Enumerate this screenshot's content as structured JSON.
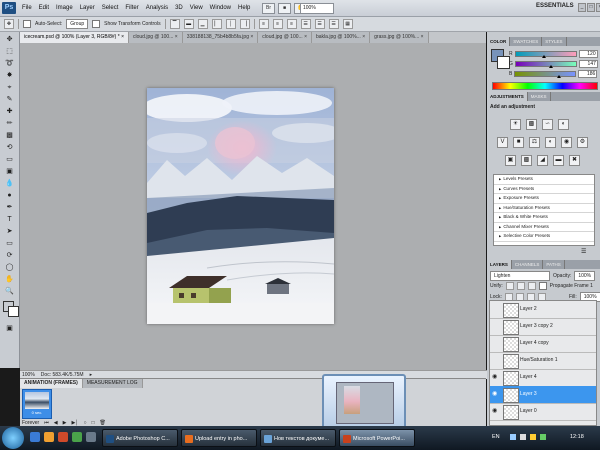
{
  "app": {
    "logo": "Ps"
  },
  "menu": [
    "File",
    "Edit",
    "Image",
    "Layer",
    "Select",
    "Filter",
    "Analysis",
    "3D",
    "View",
    "Window",
    "Help"
  ],
  "appbar": {
    "zoom": "100%",
    "workspace": "ESSENTIALS",
    "window_controls": [
      "_",
      "□",
      "×"
    ]
  },
  "options": {
    "auto_select_label": "Auto-Select:",
    "auto_select_value": "Group",
    "transform_label": "Show Transform Controls"
  },
  "doc_tabs": [
    {
      "label": "icecream.psd @ 100% (Layer 3, RGB/8#) *",
      "close": "×"
    },
    {
      "label": "cloud.jpg @ 100...",
      "close": "×"
    },
    {
      "label": "338188138_75b4b8b5fa.jpg",
      "close": "×"
    },
    {
      "label": "cloud.jpg @ 100...",
      "close": "×"
    },
    {
      "label": "bakla.jpg @ 100%...",
      "close": "×"
    },
    {
      "label": "grass.jpg @ 100%...",
      "close": "×"
    }
  ],
  "status": {
    "zoom": "100%",
    "doc": "Doc: 583.4K/5.75M"
  },
  "animation": {
    "tabs": [
      "ANIMATION (FRAMES)",
      "MEASUREMENT LOG"
    ],
    "frame_time": "0 sec.",
    "loop": "Forever"
  },
  "color_panel": {
    "tabs": [
      "COLOR",
      "SWATCHES",
      "STYLES"
    ],
    "channels": [
      {
        "label": "R",
        "value": "120",
        "position": 0.47,
        "gradient": "linear-gradient(90deg,#009dba,#ff9dba)"
      },
      {
        "label": "G",
        "value": "147",
        "position": 0.58,
        "gradient": "linear-gradient(90deg,#7800ba,#78ffba)"
      },
      {
        "label": "B",
        "value": "186",
        "position": 0.73,
        "gradient": "linear-gradient(90deg,#789300,#7893ff)"
      }
    ],
    "foreground": "#7893ba",
    "background": "#ffffff"
  },
  "adjustments": {
    "tabs": [
      "ADJUSTMENTS",
      "MASKS"
    ],
    "title": "Add an adjustment",
    "presets": [
      "Levels Presets",
      "Curves Presets",
      "Exposure Presets",
      "Hue/Saturation Presets",
      "Black & White Presets",
      "Channel Mixer Presets",
      "Selective Color Presets"
    ]
  },
  "layers_panel": {
    "tabs": [
      "LAYERS",
      "CHANNELS",
      "PATHS"
    ],
    "blend_mode": "Lighten",
    "opacity_label": "Opacity:",
    "opacity": "100%",
    "unify_label": "Unify:",
    "propagate_label": "Propagate Frame 1",
    "lock_label": "Lock:",
    "fill_label": "Fill:",
    "fill": "100%",
    "layers": [
      {
        "name": "Layer 2",
        "visible": false,
        "selected": false
      },
      {
        "name": "Layer 3 copy 2",
        "visible": false,
        "selected": false
      },
      {
        "name": "Layer 4 copy",
        "visible": false,
        "selected": false
      },
      {
        "name": "Hue/Saturation 1",
        "visible": false,
        "selected": false
      },
      {
        "name": "Layer 4",
        "visible": true,
        "selected": false
      },
      {
        "name": "Layer 3",
        "visible": true,
        "selected": true
      },
      {
        "name": "Layer 0",
        "visible": true,
        "selected": false
      }
    ]
  },
  "taskbar": {
    "tasks": [
      {
        "label": "Adobe Photoshop C...",
        "color": "#1f4f82",
        "active": false
      },
      {
        "label": "Upload entry in pho...",
        "color": "#e86d1f",
        "active": false
      },
      {
        "label": "Нов текстов докуме...",
        "color": "#6aa3d8",
        "active": false
      },
      {
        "label": "Microsoft PowerPoi...",
        "color": "#c8411d",
        "active": true
      }
    ],
    "lang": "EN",
    "clock": "12:18"
  }
}
